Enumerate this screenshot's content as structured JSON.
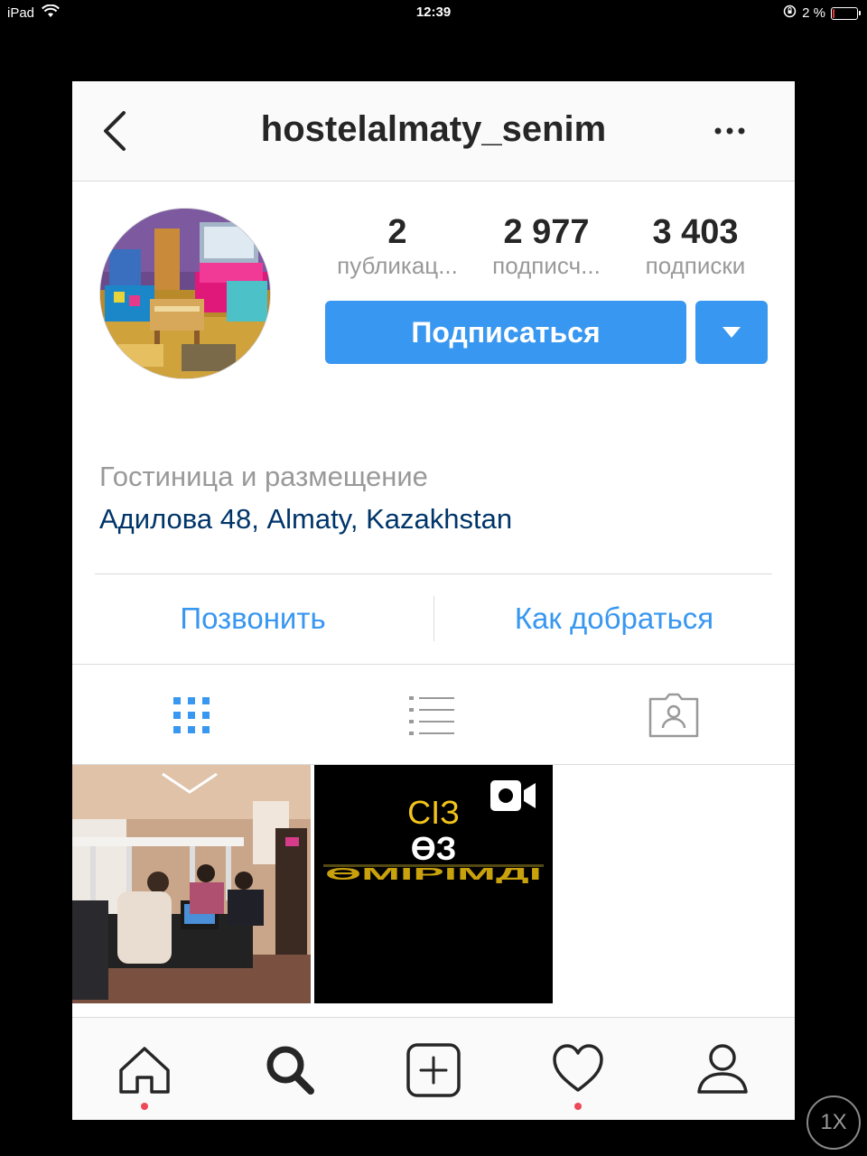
{
  "statusbar": {
    "device": "iPad",
    "time": "12:39",
    "battery_text": "2 %",
    "battery_level": 0.04
  },
  "nav": {
    "title": "hostelalmaty_senim"
  },
  "stats": [
    {
      "value": "2",
      "label": "публикац..."
    },
    {
      "value": "2 977",
      "label": "подписч..."
    },
    {
      "value": "3 403",
      "label": "подписки"
    }
  ],
  "actions": {
    "follow_label": "Подписаться"
  },
  "bio": {
    "category": "Гостиница и размещение",
    "address": "Адилова 48, Almaty, Kazakhstan"
  },
  "contact": {
    "call_label": "Позвонить",
    "directions_label": "Как добраться"
  },
  "tabs": [
    {
      "icon": "grid-icon",
      "active": true
    },
    {
      "icon": "list-icon",
      "active": false
    },
    {
      "icon": "tagged-icon",
      "active": false
    }
  ],
  "posts": [
    {
      "type": "photo",
      "label": ""
    },
    {
      "type": "video",
      "label": "СІЗ ӨЗ ӨМІРІМДІ..."
    }
  ],
  "bottom_nav": [
    {
      "icon": "home-icon",
      "notification": true
    },
    {
      "icon": "search-icon",
      "notification": false
    },
    {
      "icon": "add-post-icon",
      "notification": false
    },
    {
      "icon": "heart-icon",
      "notification": true
    },
    {
      "icon": "profile-icon",
      "notification": false
    }
  ],
  "zoom_badge": "1X",
  "colors": {
    "accent": "#3897f0",
    "link_dark": "#003569",
    "notification": "#ed4956",
    "battery_low": "#e53935"
  }
}
